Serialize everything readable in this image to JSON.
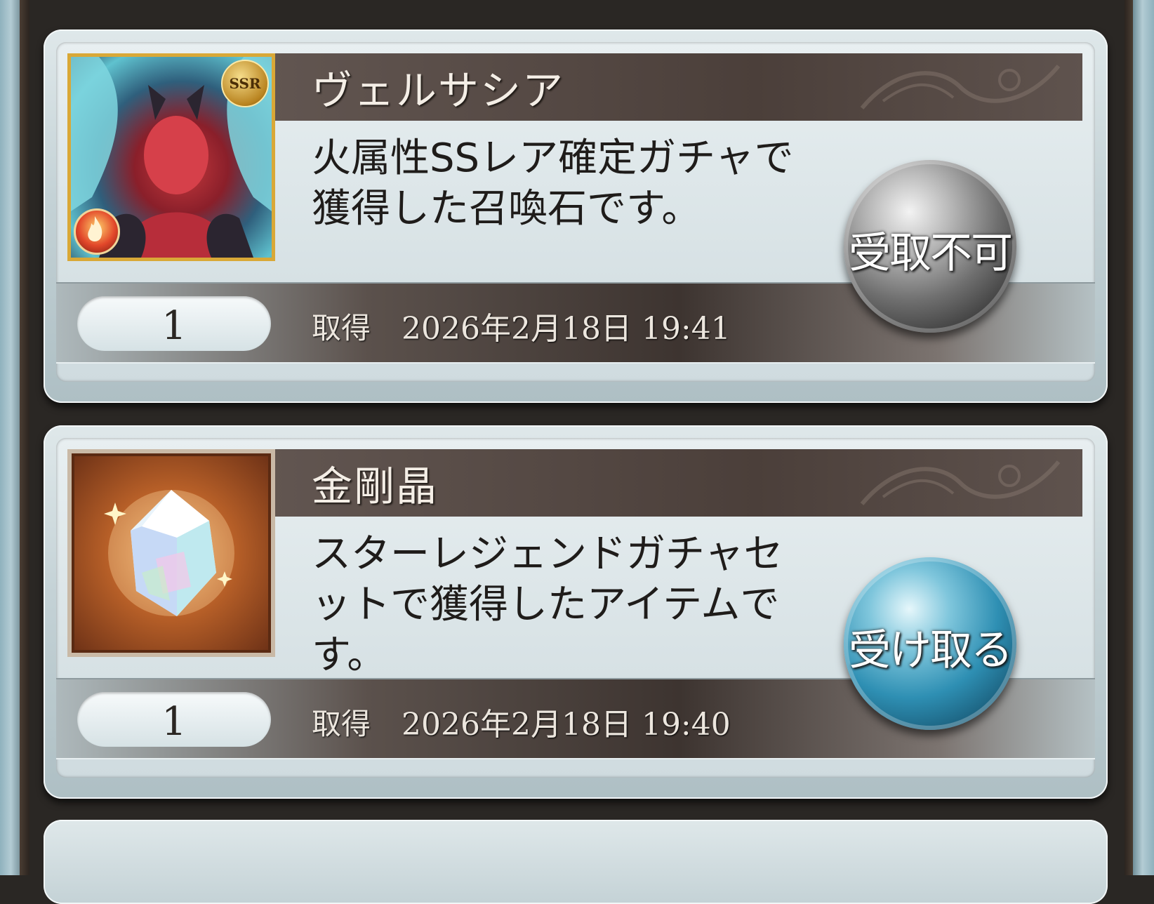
{
  "colors": {
    "card_frame": "#c4d2d6",
    "name_band": "#4b3f3a",
    "receive_orb": "#2e8fb3",
    "disabled_orb": "#6f6f6f",
    "text_light": "#f4eee6",
    "text_dark": "#1f1c1a"
  },
  "items": [
    {
      "name": "ヴェルサシア",
      "description": "火属性SSレア確定ガチャで獲得した召喚石です。",
      "quantity": "1",
      "acquired_label": "取得",
      "acquired_at": "2026年2月18日 19:41",
      "rarity_badge": "SSR",
      "element_icon": "fire-element-icon",
      "action_label": "受取不可",
      "action_enabled": false
    },
    {
      "name": "金剛晶",
      "description": "スターレジェンドガチャセットで獲得したアイテムです。",
      "quantity": "1",
      "acquired_label": "取得",
      "acquired_at": "2026年2月18日 19:40",
      "action_label": "受け取る",
      "action_enabled": true
    }
  ]
}
